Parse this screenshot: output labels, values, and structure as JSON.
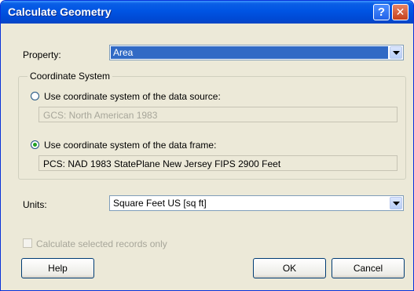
{
  "window": {
    "title": "Calculate Geometry"
  },
  "titlebar_buttons": {
    "help": "?",
    "close": "✕"
  },
  "property": {
    "label": "Property:",
    "value": "Area"
  },
  "coordinate_system": {
    "legend": "Coordinate System",
    "source_option": {
      "label": "Use coordinate system of the data source:",
      "selected": false,
      "value": "GCS: North American 1983"
    },
    "frame_option": {
      "label": "Use coordinate system of the data frame:",
      "selected": true,
      "value": "PCS: NAD 1983 StatePlane New Jersey FIPS 2900 Feet"
    }
  },
  "units": {
    "label": "Units:",
    "value": "Square Feet US [sq ft]"
  },
  "selected_only": {
    "label": "Calculate selected records only",
    "checked": false,
    "enabled": false
  },
  "buttons": {
    "help": "Help",
    "ok": "OK",
    "cancel": "Cancel"
  },
  "colors": {
    "title_bar": "#0054e3",
    "dialog_bg": "#ece9d8",
    "selection": "#316ac5",
    "radio_dot": "#21a121"
  }
}
